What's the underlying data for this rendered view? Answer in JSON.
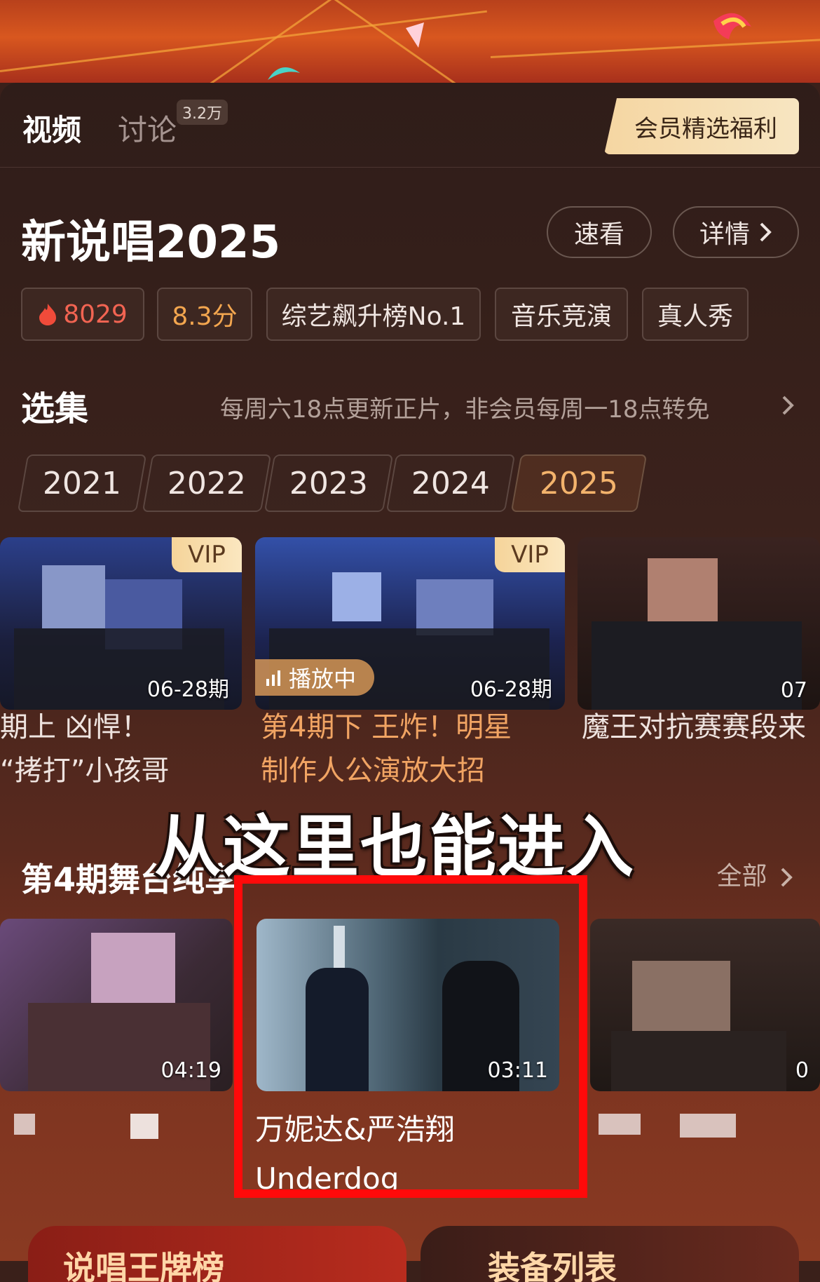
{
  "tabs": {
    "video": "视频",
    "discussion": "讨论",
    "discussion_count": "3.2万"
  },
  "vip_benefit_button": "会员精选福利",
  "show": {
    "title": "新说唱2025",
    "quick_view_button": "速看",
    "details_button": "详情",
    "heat": "8029",
    "score": "8.3分",
    "tags": [
      "综艺飙升榜No.1",
      "音乐竞演",
      "真人秀"
    ]
  },
  "episodes_section": {
    "title": "选集",
    "update_note": "每周六18点更新正片，非会员每周一18点转免",
    "seasons": [
      "2021",
      "2022",
      "2023",
      "2024",
      "2025"
    ],
    "active_season": "2025",
    "episodes": [
      {
        "badge": "VIP",
        "date": "06-28期",
        "title_line1": "期上 凶悍！",
        "title_line2": "“拷打”小孩哥",
        "playing": false
      },
      {
        "badge": "VIP",
        "date": "06-28期",
        "playing_label": "播放中",
        "title_line1": "第4期下 王炸！明星",
        "title_line2": "制作人公演放大招",
        "playing": true
      },
      {
        "badge": "",
        "date": "07",
        "title_line1": "魔王对抗赛赛段来",
        "title_line2": "",
        "playing": false
      }
    ]
  },
  "overlay_caption": "从这里也能进入",
  "clips_section": {
    "title": "第4期舞台纯享",
    "all_link": "全部",
    "clips": [
      {
        "duration": "04:19",
        "title_line1": "",
        "title_line2": ""
      },
      {
        "duration": "03:11",
        "title_line1": "万妮达&严浩翔",
        "title_line2": "Underdog"
      },
      {
        "duration": "0",
        "title_line1": "",
        "title_line2": ""
      }
    ]
  },
  "bottom_cards": [
    "说唱王牌榜",
    "装备列表"
  ],
  "colors": {
    "accent_orange": "#f1a463",
    "highlight_red": "#ff0a0a",
    "vip_gold": "#f5d49a"
  },
  "icons": [
    "flame-icon",
    "chevron-right-icon",
    "bars-icon"
  ]
}
